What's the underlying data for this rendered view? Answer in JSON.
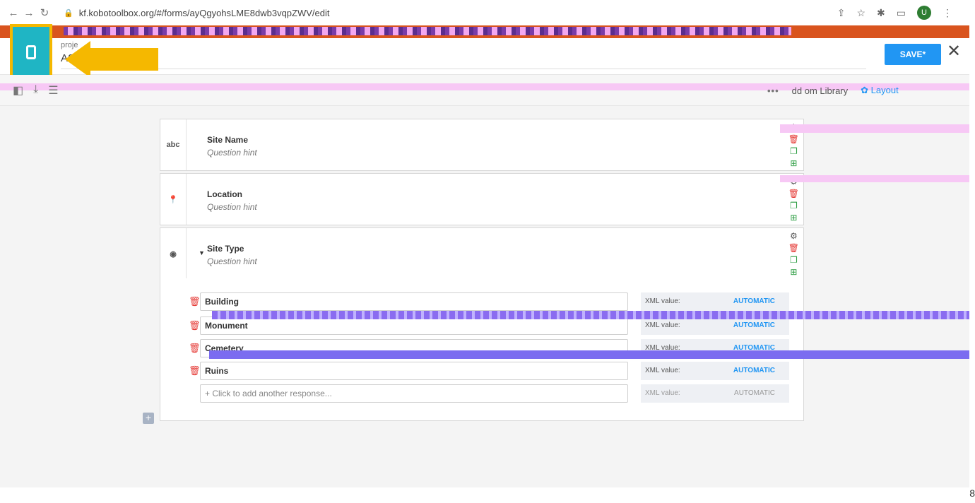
{
  "browser": {
    "url": "kf.kobotoolbox.org/#/forms/ayQgyohsLME8dwb3vqpZWV/edit",
    "profile_initial": "U"
  },
  "header": {
    "project_label": "proje",
    "title": "ASC",
    "save_label": "SAVE*",
    "close_glyph": "✕"
  },
  "toolbar": {
    "library_label": "dd   om Library",
    "layout_label": "Layout"
  },
  "questions": [
    {
      "type_label": "abc",
      "label": "Site Name",
      "hint": "Question hint"
    },
    {
      "type_label": "",
      "label": "Location",
      "hint": "Question hint"
    },
    {
      "type_label": "",
      "label": "Site Type",
      "hint": "Question hint"
    }
  ],
  "choices": {
    "xml_label": "XML value:",
    "xml_value": "AUTOMATIC",
    "items": [
      {
        "label": "Building"
      },
      {
        "label": "Monument"
      },
      {
        "label": "Cemetery"
      },
      {
        "label": "Ruins"
      }
    ],
    "add_placeholder": "+ Click to add another response..."
  },
  "footer": {
    "page_number": "8"
  },
  "colors": {
    "banner": "#d9541e",
    "accent_blue": "#2196f3",
    "form_icon": "#1fb5c4",
    "highlight": "#f5b800",
    "delete_red": "#e53935",
    "copy_green": "#2e9e44"
  },
  "icons": [
    "back-icon",
    "forward-icon",
    "reload-icon",
    "lock-icon",
    "share-icon",
    "star-icon",
    "extensions-icon",
    "window-icon",
    "form-phone-icon",
    "close-icon",
    "text-type-icon",
    "location-pin-icon",
    "radio-type-icon",
    "gear-icon",
    "trash-icon",
    "copy-icon",
    "add-to-library-icon",
    "caret-down-icon",
    "plus-icon"
  ]
}
